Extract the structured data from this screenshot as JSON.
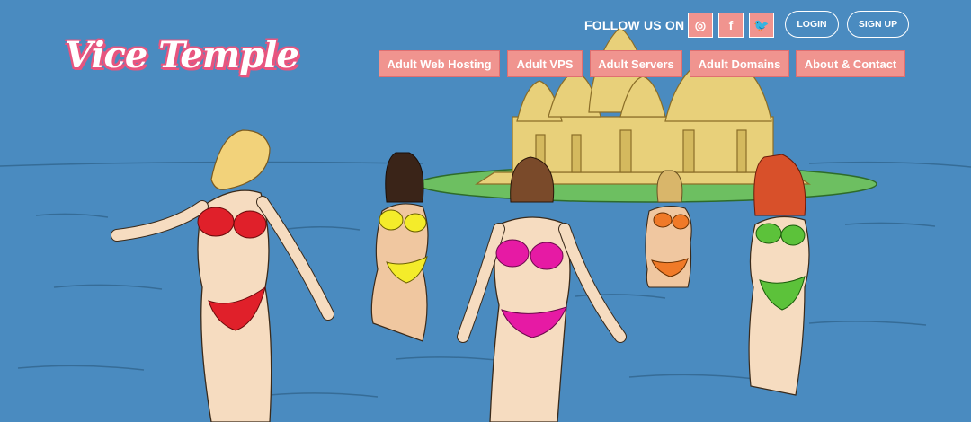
{
  "brand": {
    "logo_text": "Vice Temple"
  },
  "header": {
    "follow_label": "FOLLOW US ON",
    "social": [
      {
        "icon": "instagram-icon",
        "glyph": "◎"
      },
      {
        "icon": "facebook-icon",
        "glyph": "f"
      },
      {
        "icon": "twitter-icon",
        "glyph": "🐦"
      }
    ],
    "login_label": "LOGIN",
    "signup_label": "SIGN UP"
  },
  "nav": {
    "items": [
      "Adult Web Hosting",
      "Adult VPS",
      "Adult Servers",
      "Adult Domains",
      "About & Contact"
    ]
  },
  "colors": {
    "sky_water": "#4a8bc0",
    "accent_pink": "#f0948f",
    "logo_pink": "#e8557f",
    "island_green": "#6dbf61",
    "temple_gold": "#e8d07a"
  }
}
